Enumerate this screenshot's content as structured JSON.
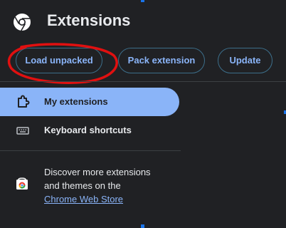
{
  "header": {
    "title": "Extensions",
    "logo_icon": "chrome-logo-icon"
  },
  "toolbar": {
    "load_unpacked": "Load unpacked",
    "pack_extension": "Pack extension",
    "update": "Update"
  },
  "sidebar": {
    "items": [
      {
        "label": "My extensions",
        "icon": "puzzle-icon",
        "selected": true
      },
      {
        "label": "Keyboard shortcuts",
        "icon": "keyboard-icon",
        "selected": false
      }
    ],
    "store_promo": {
      "text_line1": "Discover more extensions",
      "text_line2": "and themes on the",
      "link_text": "Chrome Web Store"
    }
  },
  "colors": {
    "background": "#202124",
    "accent": "#8ab4f8",
    "annotation_red": "#e01010"
  }
}
